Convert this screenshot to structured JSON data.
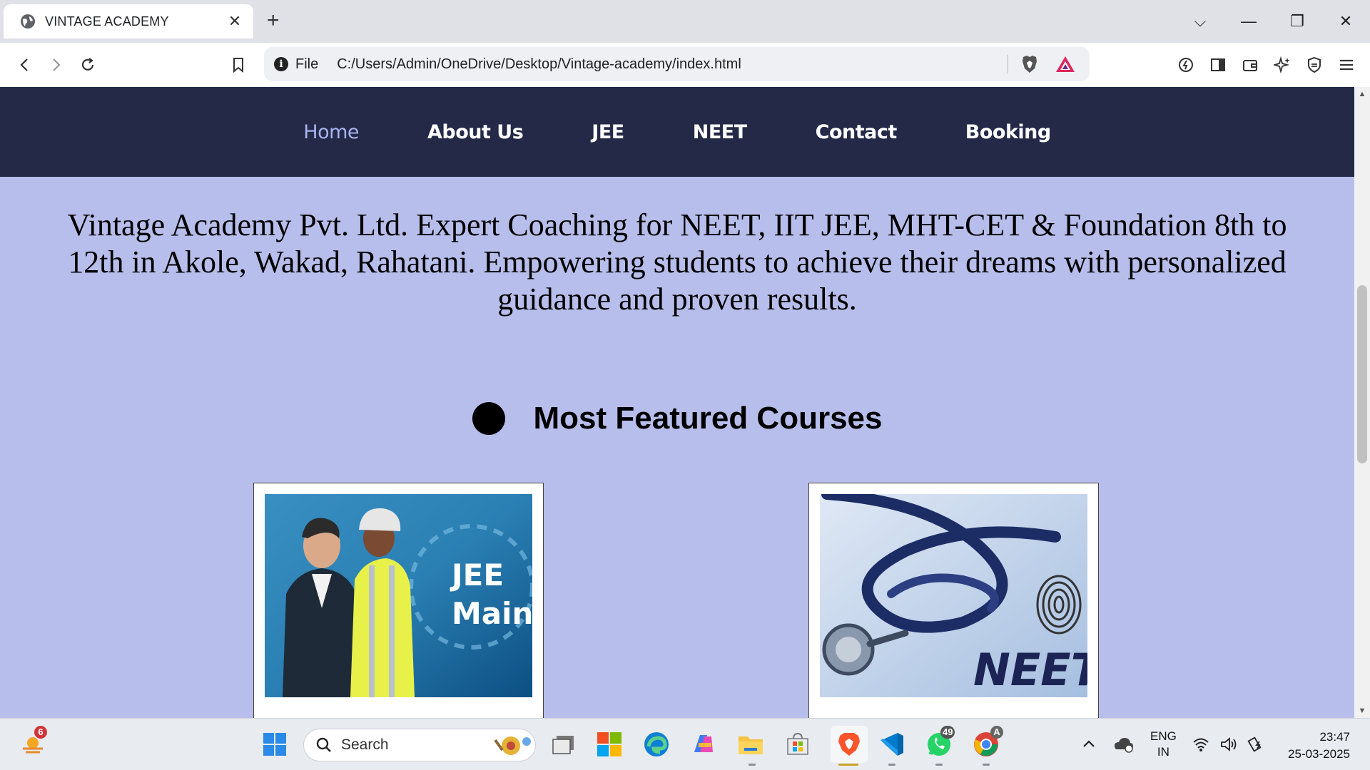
{
  "browser": {
    "tab_title": "VINTAGE ACADEMY",
    "new_tab": "+",
    "omnibox_scheme_label": "File",
    "url": "C:/Users/Admin/OneDrive/Desktop/Vintage-academy/index.html"
  },
  "site": {
    "nav": [
      "Home",
      "About Us",
      "JEE",
      "NEET",
      "Contact",
      "Booking"
    ],
    "active_nav": "Home",
    "hero_text": "Vintage Academy Pvt. Ltd. Expert Coaching for NEET, IIT JEE, MHT-CET & Foundation 8th to 12th in Akole, Wakad, Rahatani. Empowering students to achieve their dreams with personalized guidance and proven results.",
    "featured_heading": "Most Featured Courses",
    "cards": [
      {
        "image_text_1": "JEE",
        "image_text_2": "Main"
      },
      {
        "image_text_1": "NEET"
      }
    ]
  },
  "taskbar": {
    "search_placeholder": "Search",
    "widgets_badge": "6",
    "whatsapp_badge": "49",
    "chrome_badge": "A",
    "language_line1": "ENG",
    "language_line2": "IN",
    "time": "23:47",
    "date": "25-03-2025"
  },
  "colors": {
    "nav_bg": "#232947",
    "page_bg": "#b7beeb",
    "active_nav": "#a8b3f0"
  }
}
